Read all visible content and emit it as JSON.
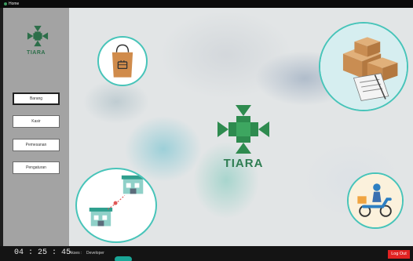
{
  "window": {
    "title": "Home"
  },
  "app": {
    "name": "TIARA",
    "brand_color": "#2e7d52",
    "accent_ring_color": "#47c4b9"
  },
  "sidebar": {
    "items": [
      {
        "label": "Barang",
        "active": true
      },
      {
        "label": "Kasir",
        "active": false
      },
      {
        "label": "Pemesanan",
        "active": false
      },
      {
        "label": "Pengaturan",
        "active": false
      }
    ]
  },
  "status": {
    "time": "04 : 25 : 45",
    "access_label": "Akses :",
    "access_value": "Developer"
  },
  "buttons": {
    "logout": "Log Out"
  },
  "icons": [
    "shopping-bag-icon",
    "packages-checklist-icon",
    "pharmacy-route-icon",
    "delivery-scooter-icon",
    "cross-logo-icon"
  ]
}
